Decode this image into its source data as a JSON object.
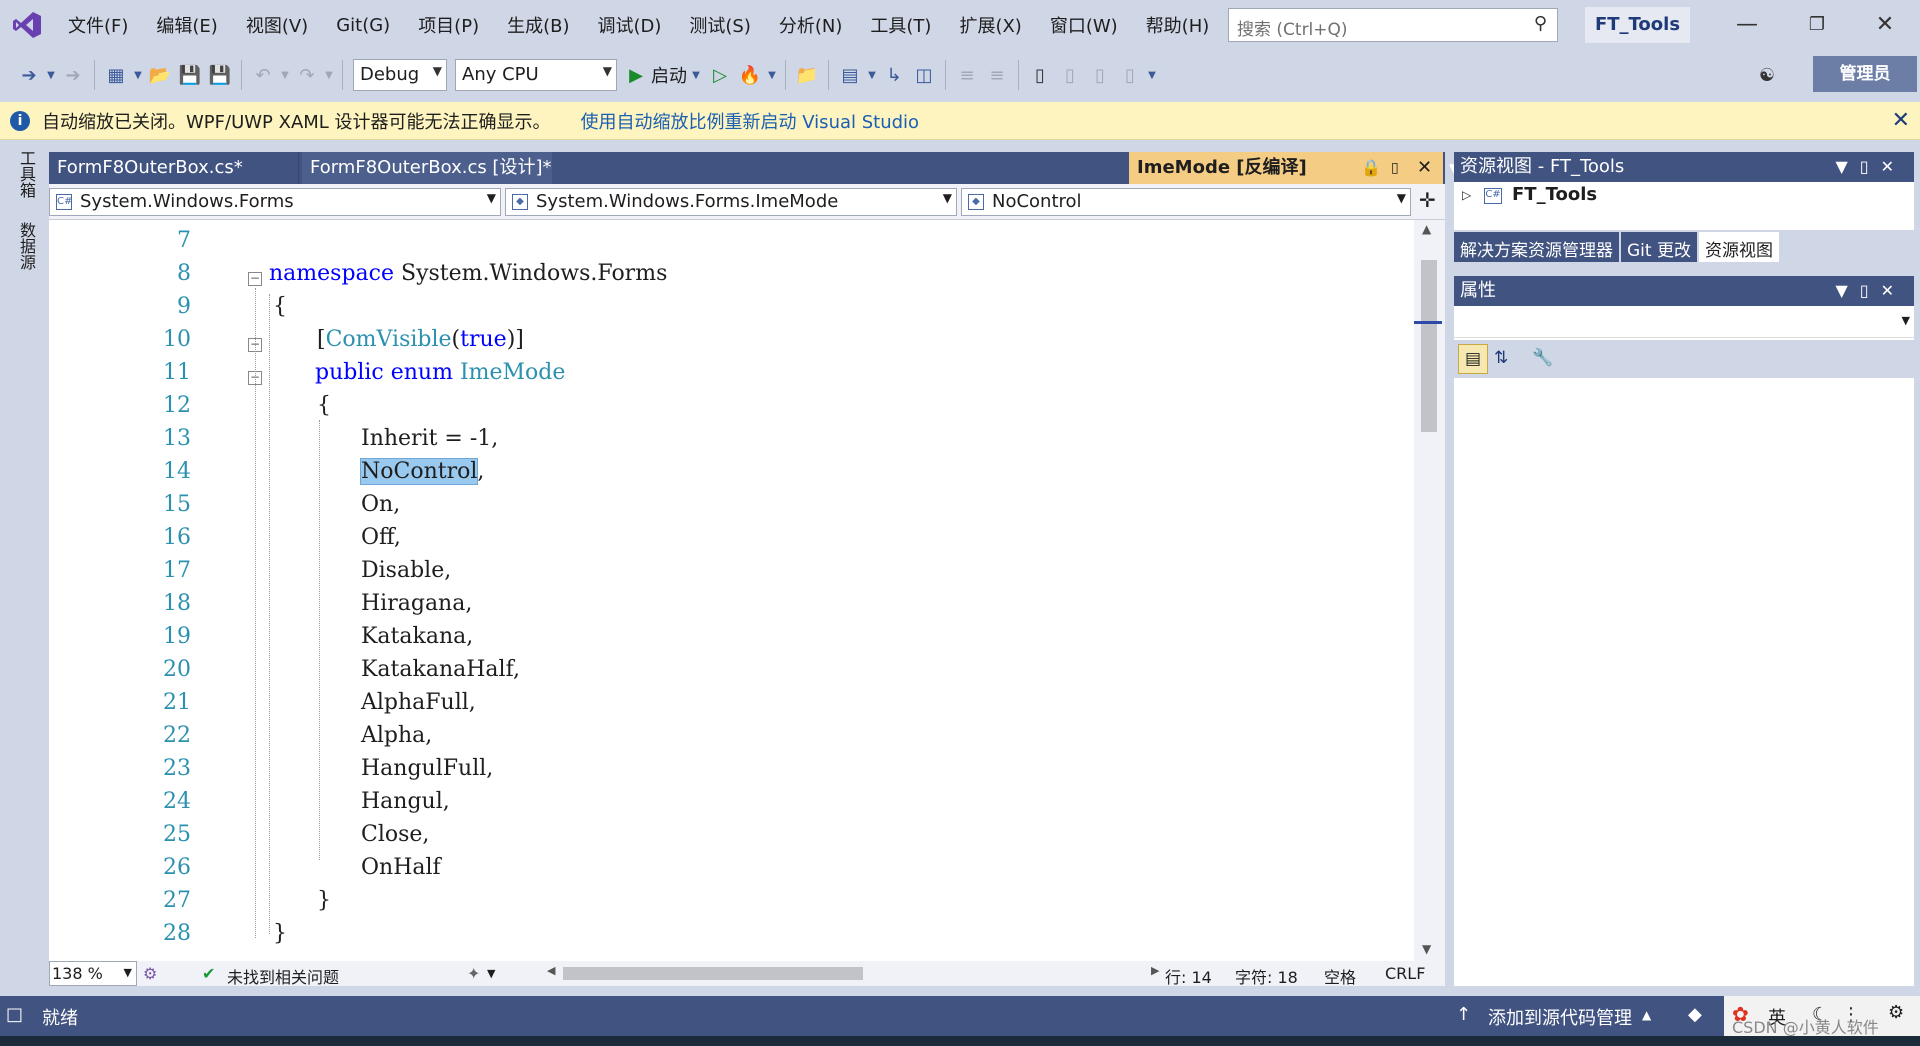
{
  "menu": [
    "文件(F)",
    "编辑(E)",
    "视图(V)",
    "Git(G)",
    "项目(P)",
    "生成(B)",
    "调试(D)",
    "测试(S)",
    "分析(N)",
    "工具(T)",
    "扩展(X)",
    "窗口(W)",
    "帮助(H)"
  ],
  "search": {
    "placeholder": "搜索 (Ctrl+Q)"
  },
  "project_name": "FT_Tools",
  "toolbar": {
    "config": "Debug",
    "platform": "Any CPU",
    "start_label": "启动",
    "admin_label": "管理员"
  },
  "infobar": {
    "message": "自动缩放已关闭。WPF/UWP XAML 设计器可能无法正确显示。",
    "link": "使用自动缩放比例重新启动 Visual Studio"
  },
  "side_tabs": [
    "工具箱",
    "数据源"
  ],
  "doc_tabs": [
    "FormF8OuterBox.cs*",
    "FormF8OuterBox.cs [设计]*",
    "ImeMode [反编译]"
  ],
  "nav": {
    "namespace": "System.Windows.Forms",
    "type": "System.Windows.Forms.ImeMode",
    "member": "NoControl"
  },
  "code": {
    "line_numbers": [
      "7",
      "8",
      "9",
      "10",
      "11",
      "12",
      "13",
      "14",
      "15",
      "16",
      "17",
      "18",
      "19",
      "20",
      "21",
      "22",
      "23",
      "24",
      "25",
      "26",
      "27",
      "28"
    ],
    "namespace_kw": "namespace",
    "namespace_name": "System.Windows.Forms",
    "open_brace": "{",
    "close_brace": "}",
    "attr_open": "[",
    "attr_name": "ComVisible",
    "attr_paren_open": "(",
    "attr_value": "true",
    "attr_close": ")]",
    "public_kw": "public",
    "enum_kw": "enum",
    "enum_name": "ImeMode",
    "first_member": "Inherit = -1,",
    "selected_member": "NoControl",
    "comma": ",",
    "members": [
      "On,",
      "Off,",
      "Disable,",
      "Hiragana,",
      "Katakana,",
      "KatakanaHalf,",
      "AlphaFull,",
      "Alpha,",
      "HangulFull,",
      "Hangul,",
      "Close,",
      "OnHalf"
    ]
  },
  "editor_status": {
    "zoom": "138 %",
    "issues": "未找到相关问题",
    "line": "行: 14",
    "char": "字符: 18",
    "space": "空格",
    "eol": "CRLF"
  },
  "resource_view": {
    "title": "资源视图 - FT_Tools",
    "root": "FT_Tools"
  },
  "panel_tabs": [
    "解决方案资源管理器",
    "Git 更改",
    "资源视图"
  ],
  "properties": {
    "title": "属性"
  },
  "statusbar": {
    "ready": "就绪",
    "source_control": "添加到源代码管理",
    "ime": "英"
  },
  "watermark": "CSDN @小黄人软件"
}
